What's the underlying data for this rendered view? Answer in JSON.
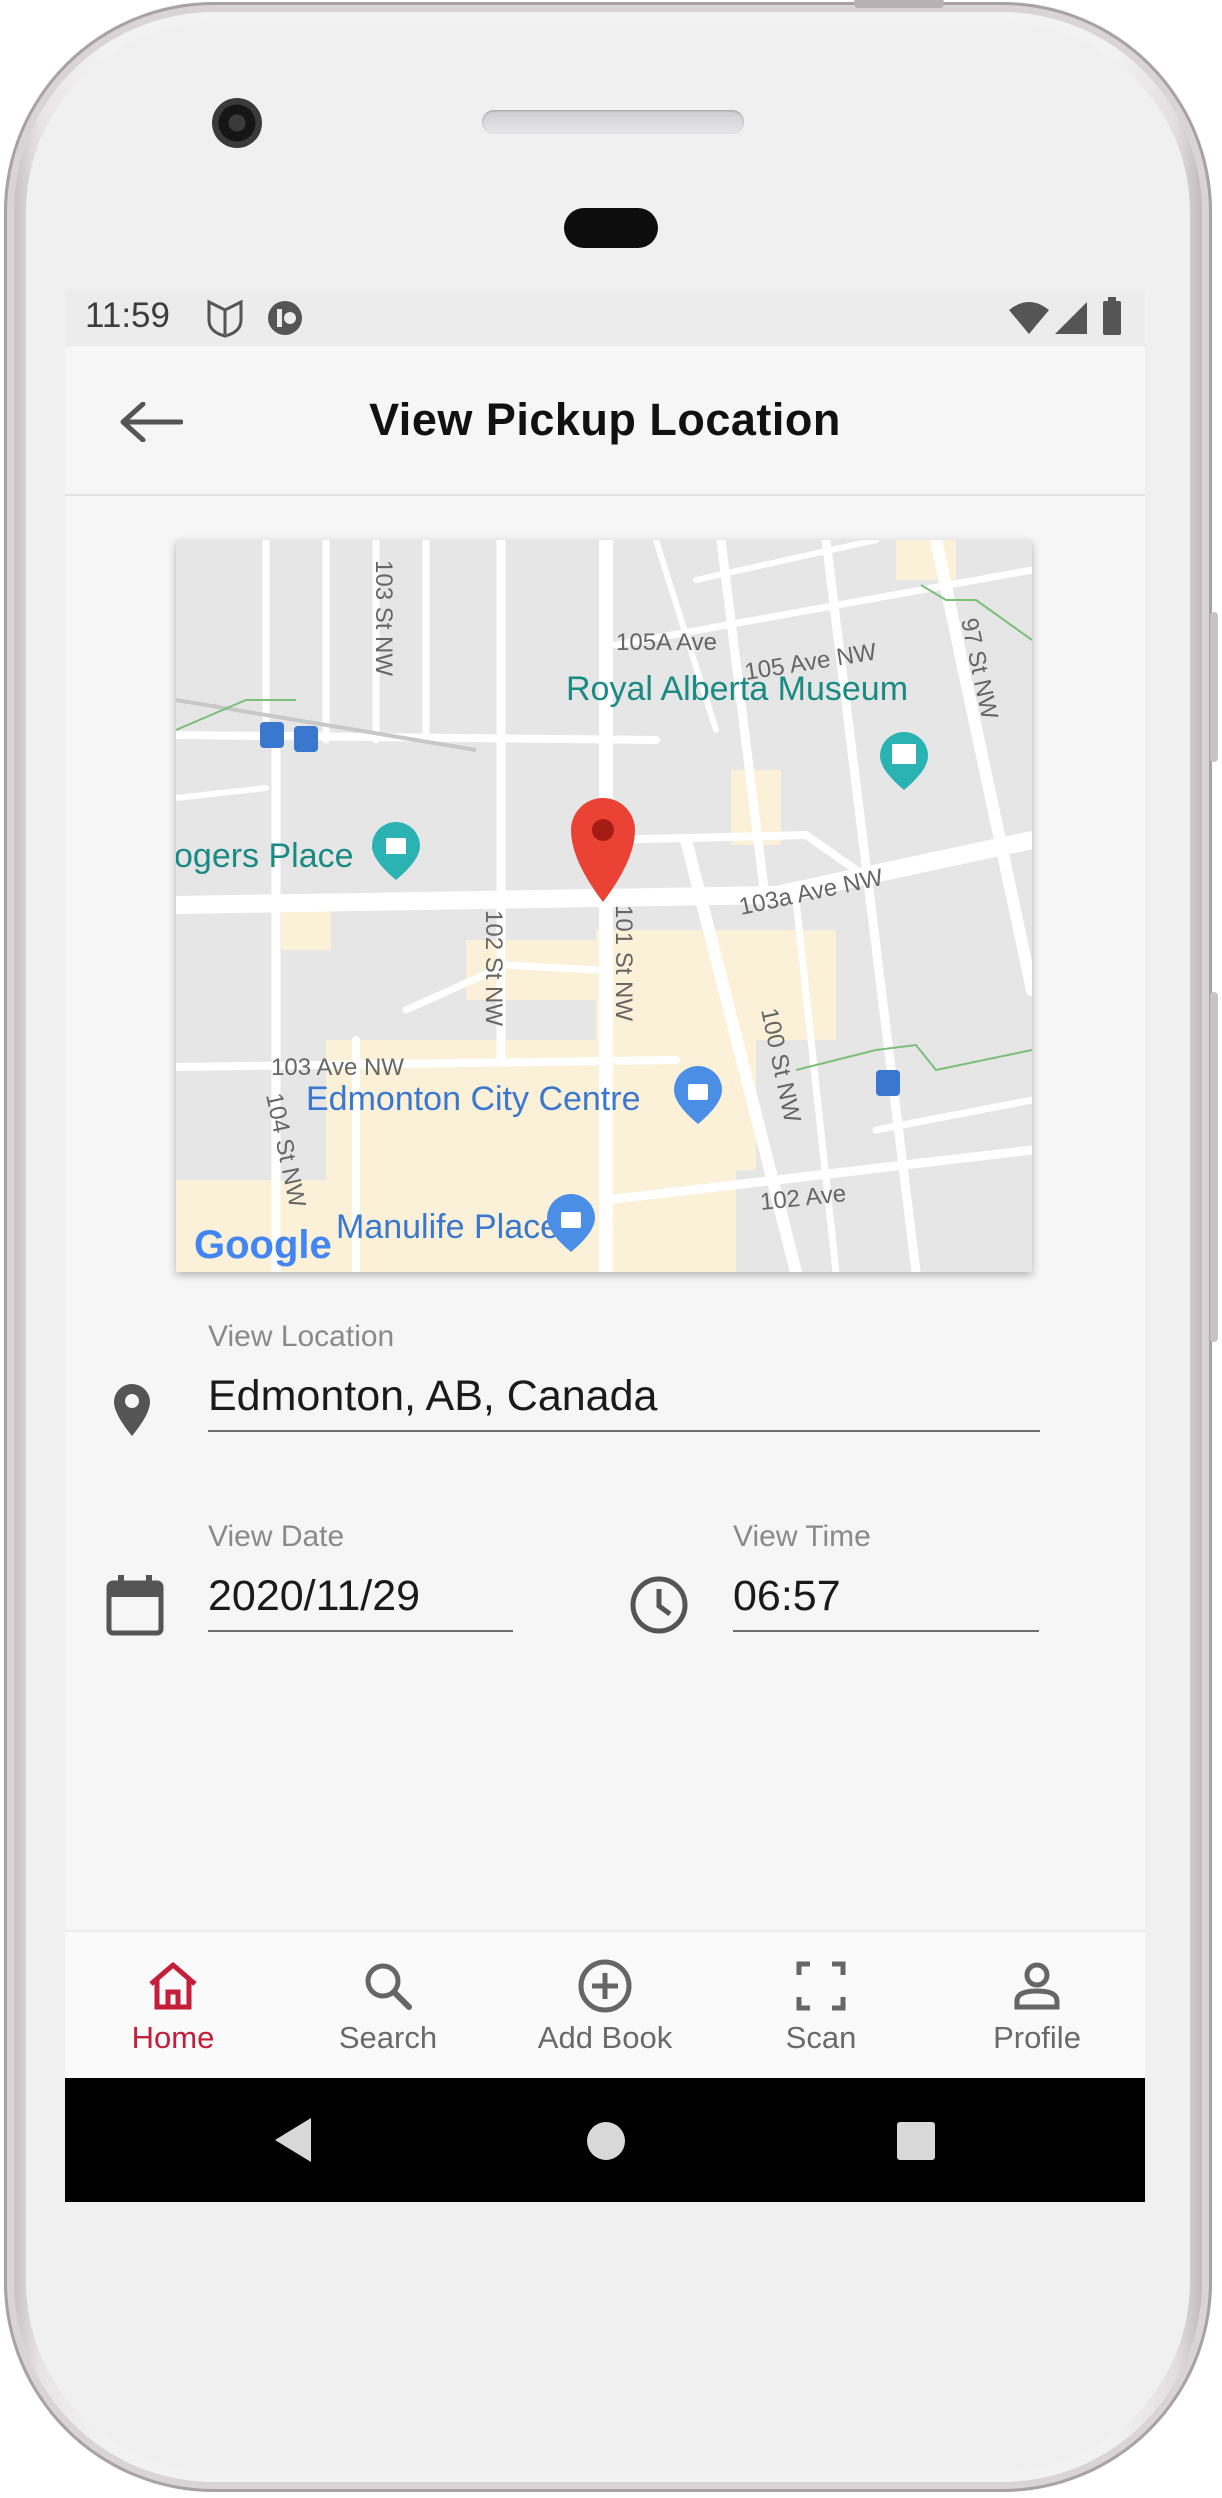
{
  "status_bar": {
    "time": "11:59",
    "icons_left": [
      "shield-notification-icon",
      "info-circle-notification-icon"
    ],
    "icons_right": [
      "wifi-icon",
      "cellular-signal-icon",
      "battery-icon"
    ]
  },
  "app_bar": {
    "title": "View Pickup Location",
    "back_icon": "arrow-left-icon"
  },
  "map": {
    "streets": [
      "103 St NW",
      "105A Ave",
      "105 Ave NW",
      "97 St NW",
      "102 St NW",
      "101 St NW",
      "103a Ave NW",
      "100 St NW",
      "103 Ave NW",
      "104 St NW",
      "102 Ave"
    ],
    "places": [
      "Royal Alberta Museum",
      "ogers Place",
      "Edmonton City Centre",
      "Manulife Place"
    ],
    "attribution": "Google",
    "marker": "red-location-pin"
  },
  "location_field": {
    "label": "View Location",
    "value": "Edmonton, AB, Canada",
    "icon": "location-pin-icon"
  },
  "date_field": {
    "label": "View Date",
    "value": "2020/11/29",
    "icon": "calendar-icon"
  },
  "time_field": {
    "label": "View Time",
    "value": "06:57",
    "icon": "clock-icon"
  },
  "bottom_nav": {
    "active_color": "#c41e3a",
    "items": [
      {
        "label": "Home",
        "icon": "home-icon",
        "active": true
      },
      {
        "label": "Search",
        "icon": "search-icon",
        "active": false
      },
      {
        "label": "Add Book",
        "icon": "add-circle-icon",
        "active": false
      },
      {
        "label": "Scan",
        "icon": "scan-frame-icon",
        "active": false
      },
      {
        "label": "Profile",
        "icon": "person-icon",
        "active": false
      }
    ]
  }
}
